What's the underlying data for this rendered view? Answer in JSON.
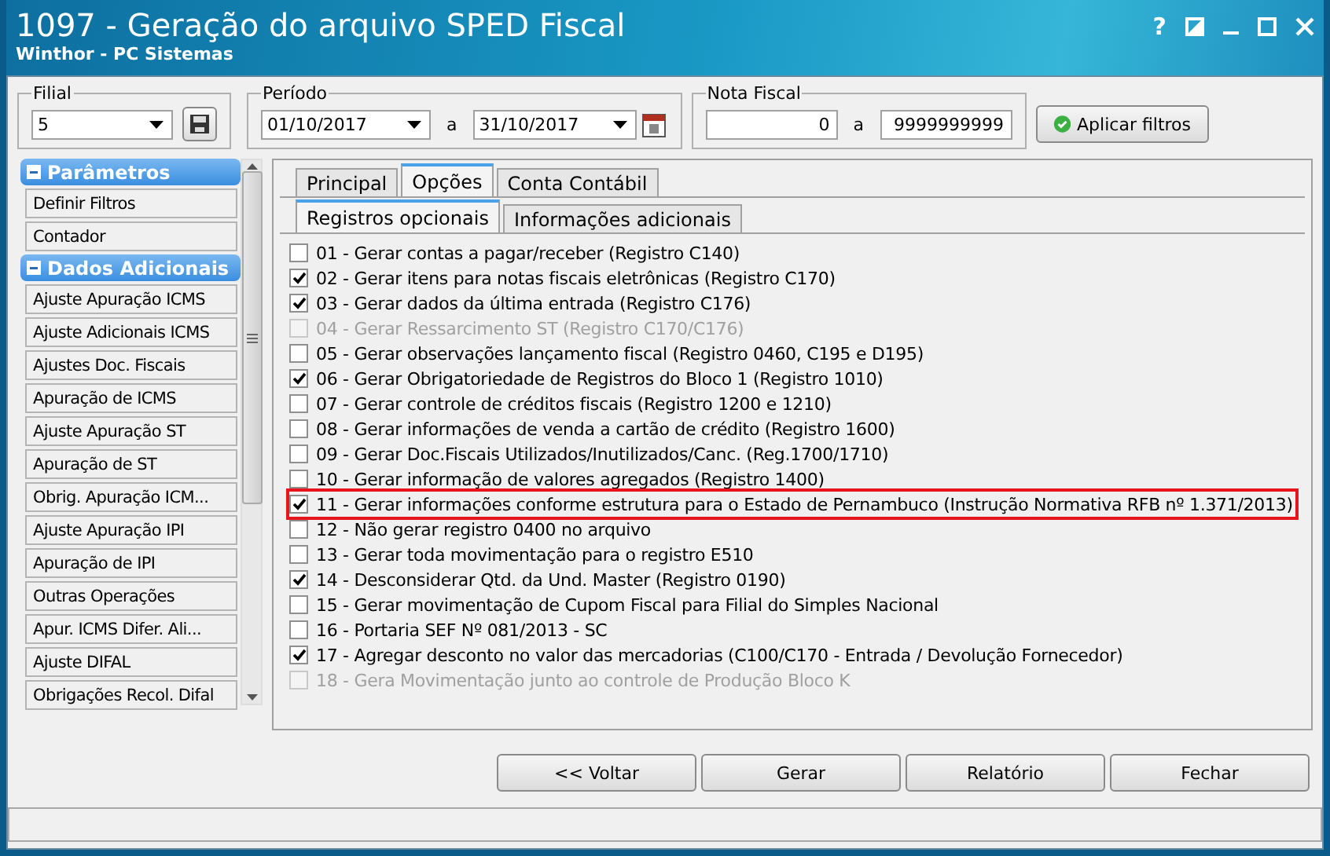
{
  "window": {
    "title": "1097 - Geração do arquivo SPED Fiscal",
    "subtitle": "Winthor - PC Sistemas",
    "help": "?"
  },
  "filters": {
    "filial": {
      "label": "Filial",
      "value": "5"
    },
    "periodo": {
      "label": "Período",
      "from": "01/10/2017",
      "separator": "a",
      "to": "31/10/2017"
    },
    "nota_fiscal": {
      "label": "Nota Fiscal",
      "from": "0",
      "separator": "a",
      "to": "9999999999"
    },
    "apply_button": "Aplicar filtros"
  },
  "sidebar": {
    "sections": [
      {
        "title": "Parâmetros",
        "expanded": true,
        "items": [
          "Definir Filtros",
          "Contador"
        ]
      },
      {
        "title": "Dados Adicionais",
        "expanded": true,
        "items": [
          "Ajuste Apuração ICMS",
          "Ajuste Adicionais ICMS",
          "Ajustes Doc. Fiscais",
          "Apuração de ICMS",
          "Ajuste Apuração ST",
          "Apuração de ST",
          "Obrig. Apuração ICM...",
          "Ajuste Apuração IPI",
          "Apuração de IPI",
          "Outras Operações",
          "Apur. ICMS Difer. Ali...",
          "Ajuste DIFAL",
          "Obrigações Recol. Difal"
        ]
      }
    ]
  },
  "tabs": [
    {
      "label": "Principal",
      "selected": false
    },
    {
      "label": "Opções",
      "selected": true
    },
    {
      "label": "Conta Contábil",
      "selected": false
    }
  ],
  "subtabs": [
    {
      "label": "Registros opcionais",
      "selected": true
    },
    {
      "label": "Informações adicionais",
      "selected": false
    }
  ],
  "options": [
    {
      "label": "01 - Gerar contas a pagar/receber (Registro C140)",
      "checked": false,
      "disabled": false,
      "highlighted": false
    },
    {
      "label": "02 - Gerar itens para notas fiscais eletrônicas (Registro C170)",
      "checked": true,
      "disabled": false,
      "highlighted": false
    },
    {
      "label": "03 - Gerar dados da última entrada (Registro C176)",
      "checked": true,
      "disabled": false,
      "highlighted": false
    },
    {
      "label": "04 - Gerar Ressarcimento ST (Registro C170/C176)",
      "checked": false,
      "disabled": true,
      "highlighted": false
    },
    {
      "label": "05 - Gerar observações lançamento fiscal (Registro 0460, C195 e D195)",
      "checked": false,
      "disabled": false,
      "highlighted": false
    },
    {
      "label": "06 - Gerar Obrigatoriedade de Registros do Bloco 1 (Registro  1010)",
      "checked": true,
      "disabled": false,
      "highlighted": false
    },
    {
      "label": "07 - Gerar controle de créditos fiscais (Registro 1200 e 1210)",
      "checked": false,
      "disabled": false,
      "highlighted": false
    },
    {
      "label": "08 - Gerar informações de venda a cartão de crédito (Registro 1600)",
      "checked": false,
      "disabled": false,
      "highlighted": false
    },
    {
      "label": "09 - Gerar Doc.Fiscais Utilizados/Inutilizados/Canc. (Reg.1700/1710)",
      "checked": false,
      "disabled": false,
      "highlighted": false
    },
    {
      "label": "10 - Gerar informação de valores agregados (Registro 1400)",
      "checked": false,
      "disabled": false,
      "highlighted": false
    },
    {
      "label": "11 - Gerar informações conforme estrutura para o Estado de Pernambuco (Instrução Normativa RFB nº 1.371/2013)",
      "checked": true,
      "disabled": false,
      "highlighted": true
    },
    {
      "label": "12 - Não gerar registro 0400 no arquivo",
      "checked": false,
      "disabled": false,
      "highlighted": false
    },
    {
      "label": "13 - Gerar toda movimentação para o registro E510",
      "checked": false,
      "disabled": false,
      "highlighted": false
    },
    {
      "label": "14 - Desconsiderar Qtd. da Und. Master (Registro 0190)",
      "checked": true,
      "disabled": false,
      "highlighted": false
    },
    {
      "label": "15 - Gerar movimentação de Cupom Fiscal para Filial do Simples Nacional",
      "checked": false,
      "disabled": false,
      "highlighted": false
    },
    {
      "label": "16 - Portaria SEF Nº 081/2013 - SC",
      "checked": false,
      "disabled": false,
      "highlighted": false
    },
    {
      "label": "17 - Agregar desconto no valor das mercadorias (C100/C170 - Entrada / Devolução Fornecedor)",
      "checked": true,
      "disabled": false,
      "highlighted": false
    },
    {
      "label": "18 - Gera Movimentação junto ao controle de Produção Bloco K",
      "checked": false,
      "disabled": true,
      "highlighted": false
    }
  ],
  "buttons": [
    "<< Voltar",
    "Gerar",
    "Relatório",
    "Fechar"
  ]
}
